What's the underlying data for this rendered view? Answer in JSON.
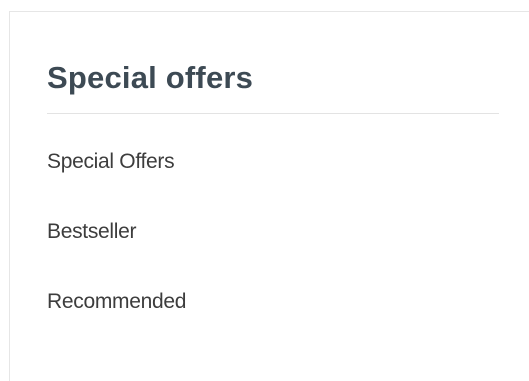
{
  "panel": {
    "title": "Special offers",
    "items": [
      {
        "label": "Special Offers"
      },
      {
        "label": "Bestseller"
      },
      {
        "label": "Recommended"
      }
    ]
  },
  "colors": {
    "heading": "#3d4a54",
    "link": "#3d3d3d",
    "divider": "#e3e3e3",
    "border": "#e6e6e6"
  }
}
